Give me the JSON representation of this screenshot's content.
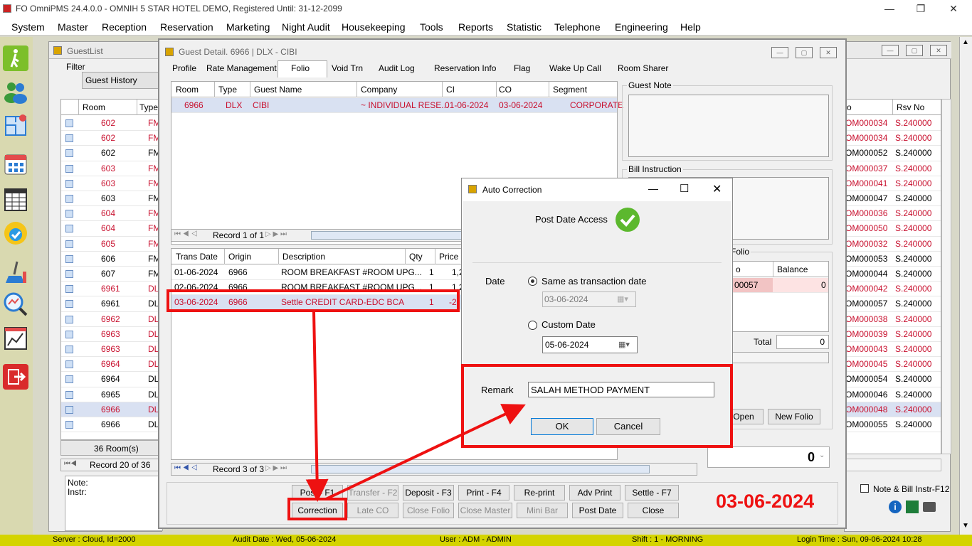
{
  "window": {
    "title": "FO OmniPMS 24.4.0.0 - OMNIH 5 STAR HOTEL DEMO, Registered Until: 31-12-2099",
    "minimize_glyph": "—",
    "restore_glyph": "❐",
    "close_glyph": "✕"
  },
  "menu": [
    "System",
    "Master",
    "Reception",
    "Reservation",
    "Marketing",
    "Night Audit",
    "Housekeeping",
    "Tools",
    "Reports",
    "Statistic",
    "Telephone",
    "Engineering",
    "Help"
  ],
  "sidebar_icons": [
    "walk-in-icon",
    "guests-icon",
    "floor-plan-icon",
    "calendar-icon",
    "year-calendar-icon",
    "availability-icon",
    "housekeeping-icon",
    "search-analytics-icon",
    "statistics-icon",
    "logout-icon"
  ],
  "guest_list": {
    "title": "GuestList",
    "filter_label": "Filter",
    "filter_value": "Guest History",
    "columns": [
      "Room",
      "Type"
    ],
    "rows": [
      {
        "room": "602",
        "type": "FM",
        "red": true
      },
      {
        "room": "602",
        "type": "FM",
        "red": true
      },
      {
        "room": "602",
        "type": "FM",
        "red": false
      },
      {
        "room": "603",
        "type": "FM",
        "red": true
      },
      {
        "room": "603",
        "type": "FM",
        "red": true
      },
      {
        "room": "603",
        "type": "FM",
        "red": false
      },
      {
        "room": "604",
        "type": "FM",
        "red": true
      },
      {
        "room": "604",
        "type": "FM",
        "red": true
      },
      {
        "room": "605",
        "type": "FM",
        "red": true
      },
      {
        "room": "606",
        "type": "FM",
        "red": false
      },
      {
        "room": "607",
        "type": "FM",
        "red": false
      },
      {
        "room": "6961",
        "type": "DL",
        "red": true
      },
      {
        "room": "6961",
        "type": "DL",
        "red": false
      },
      {
        "room": "6962",
        "type": "DL",
        "red": true
      },
      {
        "room": "6963",
        "type": "DL",
        "red": true
      },
      {
        "room": "6963",
        "type": "DL",
        "red": true
      },
      {
        "room": "6964",
        "type": "DL",
        "red": true
      },
      {
        "room": "6964",
        "type": "DL",
        "red": false
      },
      {
        "room": "6965",
        "type": "DL",
        "red": false
      },
      {
        "room": "6966",
        "type": "DL",
        "red": true
      },
      {
        "room": "6966",
        "type": "DL",
        "red": false
      }
    ],
    "rooms_count": "36 Room(s)",
    "record": "Record 20 of 36",
    "note_label": "Note:",
    "instr_label": "Instr:"
  },
  "right_panel": {
    "columns": [
      "o",
      "Rsv No"
    ],
    "rows": [
      {
        "o": "OM000034",
        "rsv": "S.240000",
        "red": true
      },
      {
        "o": "OM000034",
        "rsv": "S.240000",
        "red": true
      },
      {
        "o": "OM000052",
        "rsv": "S.240000",
        "red": false
      },
      {
        "o": "OM000037",
        "rsv": "S.240000",
        "red": true
      },
      {
        "o": "OM000041",
        "rsv": "S.240000",
        "red": true
      },
      {
        "o": "OM000047",
        "rsv": "S.240000",
        "red": false
      },
      {
        "o": "OM000036",
        "rsv": "S.240000",
        "red": true
      },
      {
        "o": "OM000050",
        "rsv": "S.240000",
        "red": true
      },
      {
        "o": "OM000032",
        "rsv": "S.240000",
        "red": true
      },
      {
        "o": "OM000053",
        "rsv": "S.240000",
        "red": false
      },
      {
        "o": "OM000044",
        "rsv": "S.240000",
        "red": false
      },
      {
        "o": "OM000042",
        "rsv": "S.240000",
        "red": true
      },
      {
        "o": "OM000057",
        "rsv": "S.240000",
        "red": false
      },
      {
        "o": "OM000038",
        "rsv": "S.240000",
        "red": true
      },
      {
        "o": "OM000039",
        "rsv": "S.240000",
        "red": true
      },
      {
        "o": "OM000043",
        "rsv": "S.240000",
        "red": true
      },
      {
        "o": "OM000045",
        "rsv": "S.240000",
        "red": true
      },
      {
        "o": "OM000054",
        "rsv": "S.240000",
        "red": false
      },
      {
        "o": "OM000046",
        "rsv": "S.240000",
        "red": false
      },
      {
        "o": "OM000048",
        "rsv": "S.240000",
        "red": true
      },
      {
        "o": "OM000055",
        "rsv": "S.240000",
        "red": false
      }
    ],
    "note_checkbox": "Note & Bill Instr-F12"
  },
  "guest_detail": {
    "title": "Guest Detail. 6966 | DLX - CIBI",
    "tabs": [
      "Profile",
      "Rate Management",
      "Folio",
      "Void Trn",
      "Audit Log",
      "Reservation Info",
      "Flag",
      "Wake Up Call",
      "Room Sharer"
    ],
    "active_tab": "Folio",
    "res_columns": [
      "Room",
      "Type",
      "Guest Name",
      "Company",
      "CI",
      "CO",
      "Segment"
    ],
    "res_row": {
      "room": "6966",
      "type": "DLX",
      "guest": "CIBI",
      "company": "~ INDIVIDUAL RESE...",
      "ci": "01-06-2024",
      "co": "03-06-2024",
      "segment": "CORPORATE"
    },
    "res_record": "Record 1 of 1",
    "trans_columns": [
      "Trans Date",
      "Origin",
      "Description",
      "Qty",
      "Price"
    ],
    "trans_rows": [
      {
        "date": "01-06-2024",
        "origin": "6966",
        "desc": "ROOM BREAKFAST #ROOM UPG...",
        "qty": "1",
        "price": "1,2"
      },
      {
        "date": "02-06-2024",
        "origin": "6966",
        "desc": "ROOM BREAKFAST #ROOM UPG...",
        "qty": "1",
        "price": "1,2"
      },
      {
        "date": "03-06-2024",
        "origin": "6966",
        "desc": "Settle CREDIT CARD-EDC BCA",
        "qty": "1",
        "price": "-2,"
      }
    ],
    "trans_record": "Record 3 of 3",
    "guest_note_label": "Guest Note",
    "bill_instruction_label": "Bill Instruction",
    "folio_group_label": "Folio",
    "folio_columns": [
      "o",
      "Balance"
    ],
    "folio_row": {
      "o": "00057",
      "balance": "0"
    },
    "total_label": "Total",
    "total_value": "0",
    "open_button": "Open",
    "new_folio_button": "New Folio",
    "deposit_value": "0",
    "buttons_row1": [
      "Post - F1",
      "Transfer - F2",
      "Deposit - F3",
      "Print - F4",
      "Re-print",
      "Adv Print",
      "Settle - F7"
    ],
    "buttons_row2": [
      "Correction",
      "Late CO",
      "Close Folio",
      "Close Master",
      "Mini Bar",
      "Post Date",
      "Close"
    ],
    "big_date": "03-06-2024"
  },
  "dialog": {
    "title": "Auto Correction",
    "post_date_access": "Post Date Access",
    "date_label": "Date",
    "same_date_label": "Same as transaction date",
    "same_date_value": "03-06-2024",
    "custom_date_label": "Custom Date",
    "custom_date_value": "05-06-2024",
    "remark_label": "Remark",
    "remark_value": "SALAH METHOD PAYMENT",
    "ok_button": "OK",
    "cancel_button": "Cancel"
  },
  "status": {
    "server": "Server : Cloud, Id=2000",
    "audit_date": "Audit Date : Wed, 05-06-2024",
    "user": "User : ADM - ADMIN",
    "shift": "Shift : 1 - MORNING",
    "login_time": "Login Time : Sun, 09-06-2024 10:28"
  },
  "colors": {
    "red_text": "#c8102e",
    "annotation_red": "#ee1111",
    "status_bar": "#d4d400",
    "selected_row": "#d9e1f2"
  }
}
